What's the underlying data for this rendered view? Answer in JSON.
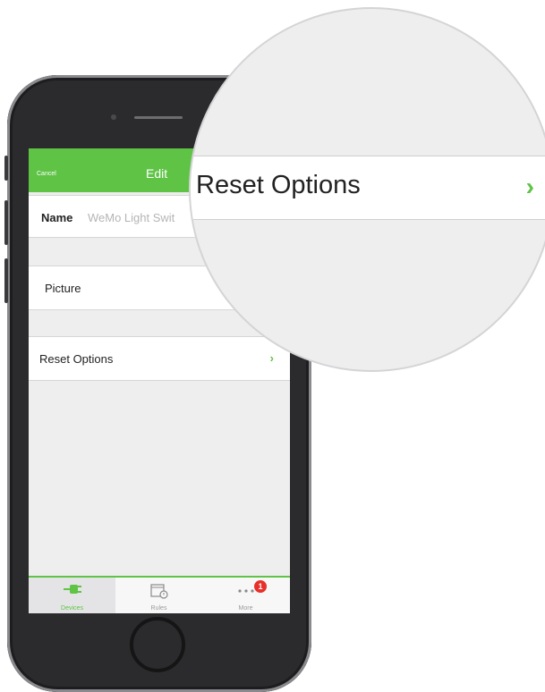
{
  "navbar": {
    "cancel_label": "Cancel",
    "title": "Edit"
  },
  "settings": {
    "name_label": "Name",
    "name_value": "WeMo Light Swit",
    "picture_label": "Picture",
    "reset_label": "Reset Options",
    "chevron": "›"
  },
  "tabbar": {
    "tabs": [
      {
        "label": "Devices",
        "icon": "plug-icon",
        "active": true
      },
      {
        "label": "Rules",
        "icon": "calendar-clock-icon",
        "active": false
      },
      {
        "label": "More",
        "icon": "more-dots-icon",
        "active": false
      }
    ],
    "more_badge": "1"
  },
  "magnifier": {
    "label": "Reset Options",
    "chevron": "›"
  },
  "colors": {
    "accent": "#5fc346",
    "badge": "#e8302a",
    "phone": "#2b2b2d"
  }
}
